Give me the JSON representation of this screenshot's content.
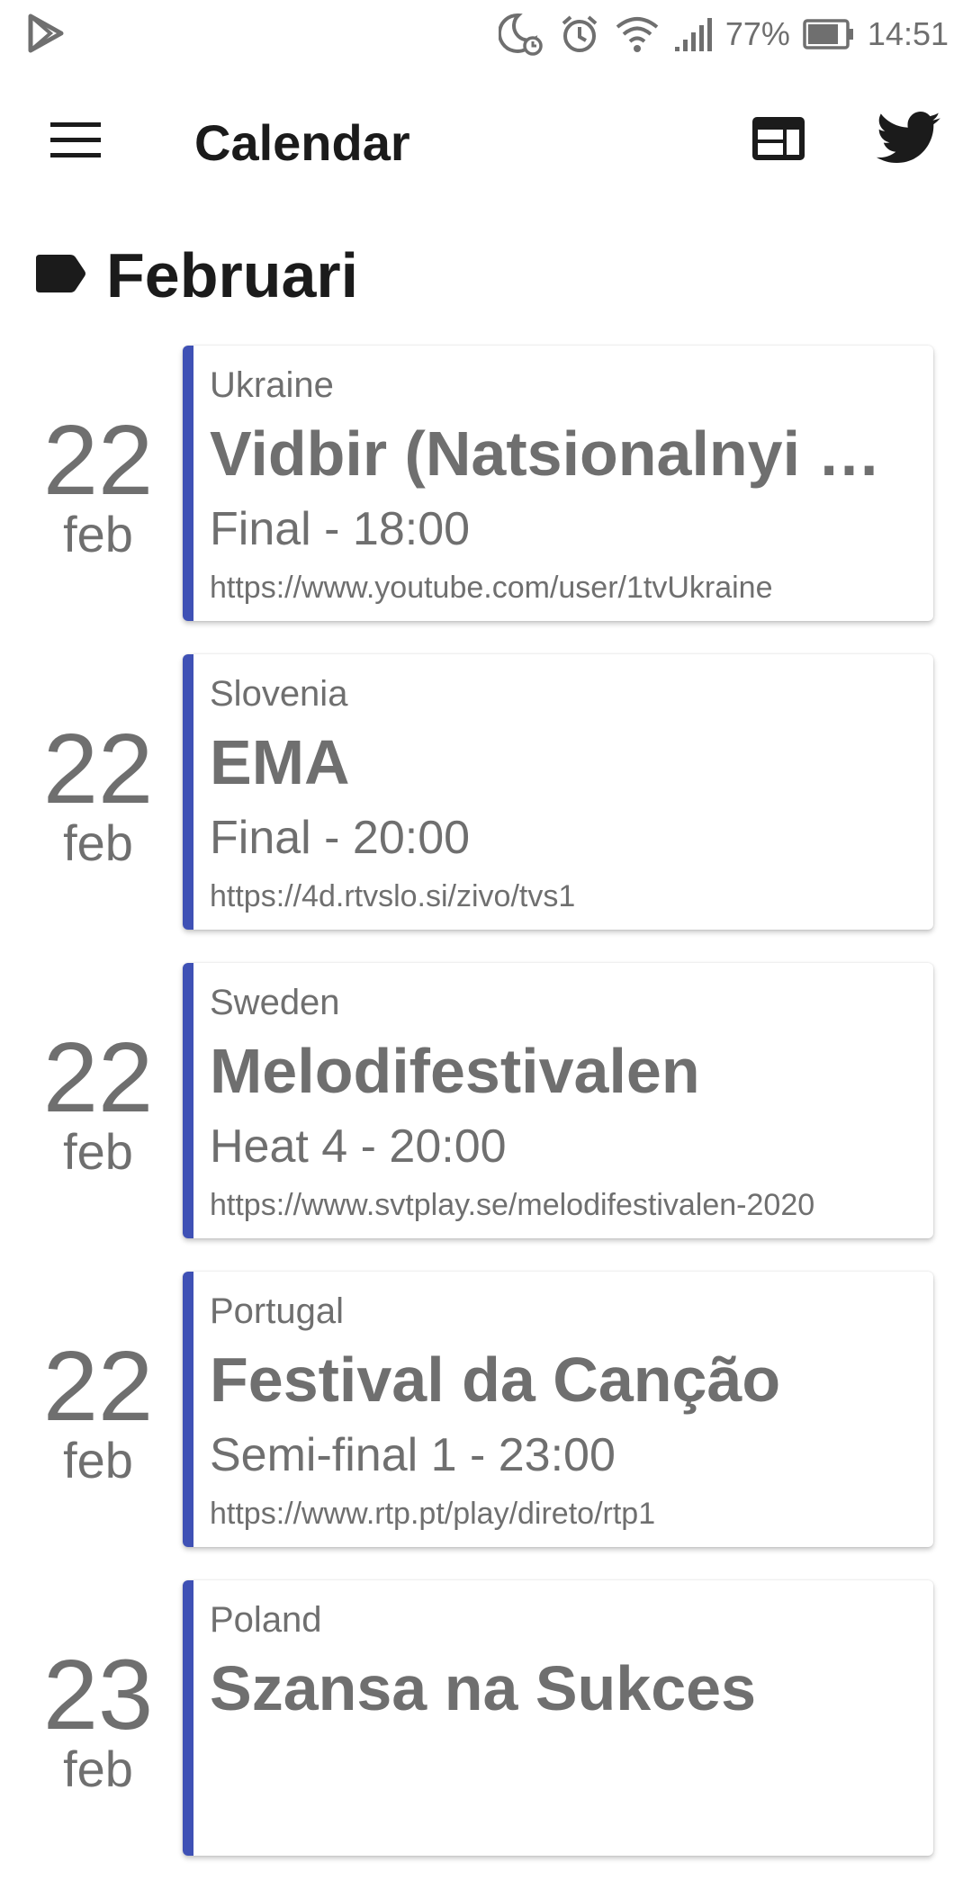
{
  "status_bar": {
    "battery_percent": "77%",
    "time": "14:51",
    "icons": [
      "play-store-icon",
      "do-not-disturb-icon",
      "alarm-icon",
      "wifi-icon",
      "signal-icon",
      "battery-icon"
    ]
  },
  "app_bar": {
    "title": "Calendar",
    "icons": [
      "menu-icon",
      "web-icon",
      "twitter-icon"
    ]
  },
  "section": {
    "title": "Februari",
    "icon": "label-icon"
  },
  "colors": {
    "accent": "#3f51b5",
    "text_primary": "#1b1b1b",
    "text_secondary": "#6f6f6f"
  },
  "events": [
    {
      "day": "22",
      "month": "feb",
      "country": "Ukraine",
      "name": "Vidbir (Natsionalnyi V…",
      "time": "Final - 18:00",
      "url": "https://www.youtube.com/user/1tvUkraine"
    },
    {
      "day": "22",
      "month": "feb",
      "country": "Slovenia",
      "name": "EMA",
      "time": "Final - 20:00",
      "url": "https://4d.rtvslo.si/zivo/tvs1"
    },
    {
      "day": "22",
      "month": "feb",
      "country": "Sweden",
      "name": "Melodifestivalen",
      "time": "Heat 4 - 20:00",
      "url": "https://www.svtplay.se/melodifestivalen-2020"
    },
    {
      "day": "22",
      "month": "feb",
      "country": "Portugal",
      "name": "Festival da Canção",
      "time": "Semi-final 1 - 23:00",
      "url": "https://www.rtp.pt/play/direto/rtp1"
    },
    {
      "day": "23",
      "month": "feb",
      "country": "Poland",
      "name": "Szansa na Sukces",
      "time": "",
      "url": ""
    }
  ]
}
